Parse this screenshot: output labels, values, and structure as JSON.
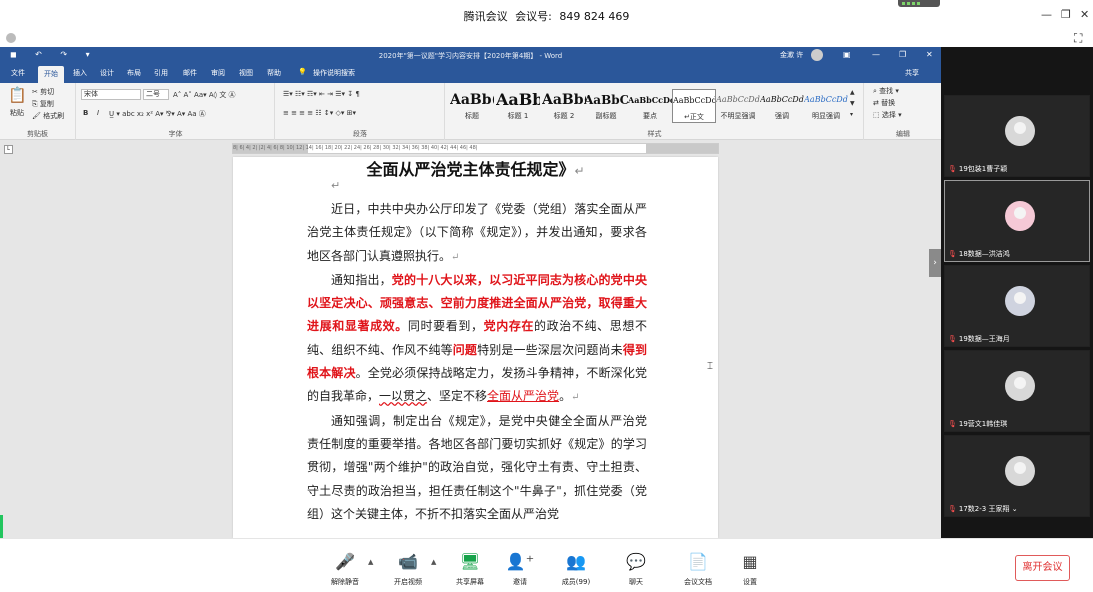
{
  "meeting": {
    "app_name": "腾讯会议",
    "id_label": "会议号:",
    "id_value": "849 824 469",
    "min": "—",
    "restore": "❐",
    "close": "✕",
    "fullscreen": "⛶"
  },
  "word": {
    "window_title": "2020年\"第一议题\"学习内容安排【2020年第4期】 - Word",
    "user_name": "金漱 许",
    "quick_access": "◼ ↶ ↷ ▾",
    "tabs": [
      "文件",
      "开始",
      "插入",
      "设计",
      "布局",
      "引用",
      "邮件",
      "审阅",
      "视图",
      "帮助"
    ],
    "tell_me": "操作说明搜索",
    "share": "共享",
    "clipboard": {
      "paste": "粘贴",
      "cut": "剪切",
      "copy": "复制",
      "painter": "格式刷",
      "label": "剪贴板"
    },
    "font": {
      "name": "宋体",
      "size": "二号",
      "label": "字体"
    },
    "paragraph_label": "段落",
    "styles": {
      "label": "样式",
      "items": [
        {
          "sample": "AaBb(",
          "name": "标题"
        },
        {
          "sample": "AaBb",
          "name": "标题 1"
        },
        {
          "sample": "AaBb(",
          "name": "标题 2"
        },
        {
          "sample": "AaBbC",
          "name": "副标题"
        },
        {
          "sample": "AaBbCcDc",
          "name": "要点"
        },
        {
          "sample": "AaBbCcDd",
          "name": "↵正文"
        },
        {
          "sample": "AaBbCcDd",
          "name": "不明显强调"
        },
        {
          "sample": "AaBbCcDd",
          "name": "强调"
        },
        {
          "sample": "AaBbCcDd",
          "name": "明显强调"
        }
      ]
    },
    "editing": {
      "find": "查找",
      "replace": "替换",
      "select": "选择",
      "label": "编辑"
    },
    "ruler_text": "8| 6| 4| 2| |2| 4| 6| 8| 10| 12| 14| 16| 18| 20| 22| 24| 26| 28| 30| 32| 34| 36| 38| 40| 42| 44| 46| 48|",
    "doc": {
      "title": "全面从严治党主体责任规定》",
      "p1": "近日，中共中央办公厅印发了《党委（党组）落实全面从严治党主体责任规定》（以下简称《规定》），并发出通知，要求各地区各部门认真遵照执行。",
      "p2_a": "通知指出，",
      "p2_b": "党的十八大以来，以习近平同志为核心的党中央以坚定决心、顽强意志、空前力度推进全面从严治党，取得重大进展和显著成效。",
      "p2_c": "同时要看到，",
      "p2_d": "党内存在",
      "p2_e": "的政治不纯、思想不纯、组织不纯、作风不纯等",
      "p2_f": "问题",
      "p2_g": "特别是一些深层次问题尚未",
      "p2_h": "得到根本解决",
      "p2_i": "。全党必须保持战略定力，发扬斗争精神，不断深化党的自我革命，",
      "p2_j": "一以贯之",
      "p2_k": "、坚定不移",
      "p2_l": "全面从严治党",
      "p2_m": "。",
      "p3": "通知强调，制定出台《规定》，是党中央健全全面从严治党责任制度的重要举措。各地区各部门要切实抓好《规定》的学习贯彻，增强\"两个维护\"的政治自觉，强化守土有责、守土担责、守土尽责的政治担当，担任责任制这个\"牛鼻子\"，抓住党委（党组）这个关键主体，不折不扣落实全面从严治党"
    }
  },
  "participants": [
    {
      "name": "19包装1曹子颖"
    },
    {
      "name": "18数据—洪洁鸿"
    },
    {
      "name": "19数据—王海月"
    },
    {
      "name": "19营文1韩佳琪"
    },
    {
      "name": "17数2-3 王家翔"
    }
  ],
  "toolbar": {
    "mute": "解除静音",
    "video": "开启视频",
    "share": "共享屏幕",
    "invite": "邀请",
    "members": "成员(99)",
    "chat": "聊天",
    "docs": "会议文档",
    "settings": "设置",
    "leave": "离开会议"
  }
}
